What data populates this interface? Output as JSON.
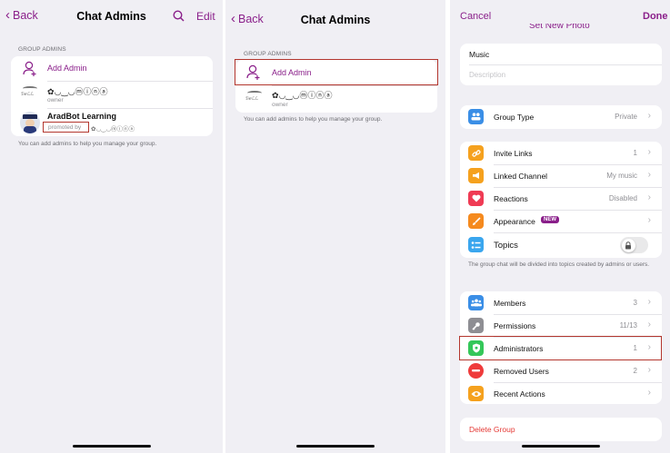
{
  "panel1": {
    "back": "Back",
    "title": "Chat Admins",
    "edit": "Edit",
    "section": "GROUP ADMINS",
    "add_admin": "Add Admin",
    "admin1_name": "✿◡‿◡ⓜⓘⓝⓐ",
    "admin1_role": "owner",
    "admin2_name": "AradBot Learning",
    "admin2_promoted": "promoted by",
    "admin2_promoter": "✿◡‿◡ⓜⓘⓝⓐ",
    "footnote": "You can add admins to help you manage your group."
  },
  "panel2": {
    "back": "Back",
    "title": "Chat Admins",
    "section": "GROUP ADMINS",
    "add_admin": "Add Admin",
    "admin1_name": "✿◡‿◡ⓜⓘⓝⓐ",
    "admin1_role": "owner",
    "footnote": "You can add admins to help you manage your group."
  },
  "panel3": {
    "cancel": "Cancel",
    "done": "Done",
    "set_photo": "Set New Photo",
    "name_value": "Music",
    "description_placeholder": "Description",
    "group_type": {
      "label": "Group Type",
      "value": "Private"
    },
    "items_a": [
      {
        "label": "Invite Links",
        "value": "1",
        "icon": "link-icon",
        "color": "#f5a11e"
      },
      {
        "label": "Linked Channel",
        "value": "My music",
        "icon": "megaphone-icon",
        "color": "#f5a11e"
      },
      {
        "label": "Reactions",
        "value": "Disabled",
        "icon": "heart-icon",
        "color": "#ef3b54"
      },
      {
        "label": "Appearance",
        "value": "",
        "badge": "NEW",
        "icon": "brush-icon",
        "color": "#f58a1e"
      },
      {
        "label": "Topics",
        "value": "",
        "icon": "topics-icon",
        "color": "#3aa6ee"
      }
    ],
    "topics_note": "The group chat will be divided into topics created by admins or users.",
    "items_b": [
      {
        "label": "Members",
        "value": "3",
        "icon": "members-icon",
        "color": "#3a8ee6"
      },
      {
        "label": "Permissions",
        "value": "11/13",
        "icon": "key-icon",
        "color": "#8e8e93"
      },
      {
        "label": "Administrators",
        "value": "1",
        "icon": "shield-icon",
        "color": "#34c759"
      },
      {
        "label": "Removed Users",
        "value": "2",
        "icon": "minus-icon",
        "color": "#ef3b3b"
      },
      {
        "label": "Recent Actions",
        "value": "",
        "icon": "eye-icon",
        "color": "#f5a11e"
      }
    ],
    "delete_group": "Delete Group"
  },
  "colors": {
    "accent": "#8a1f8a",
    "highlight": "#b3362e",
    "delete": "#e53935"
  }
}
